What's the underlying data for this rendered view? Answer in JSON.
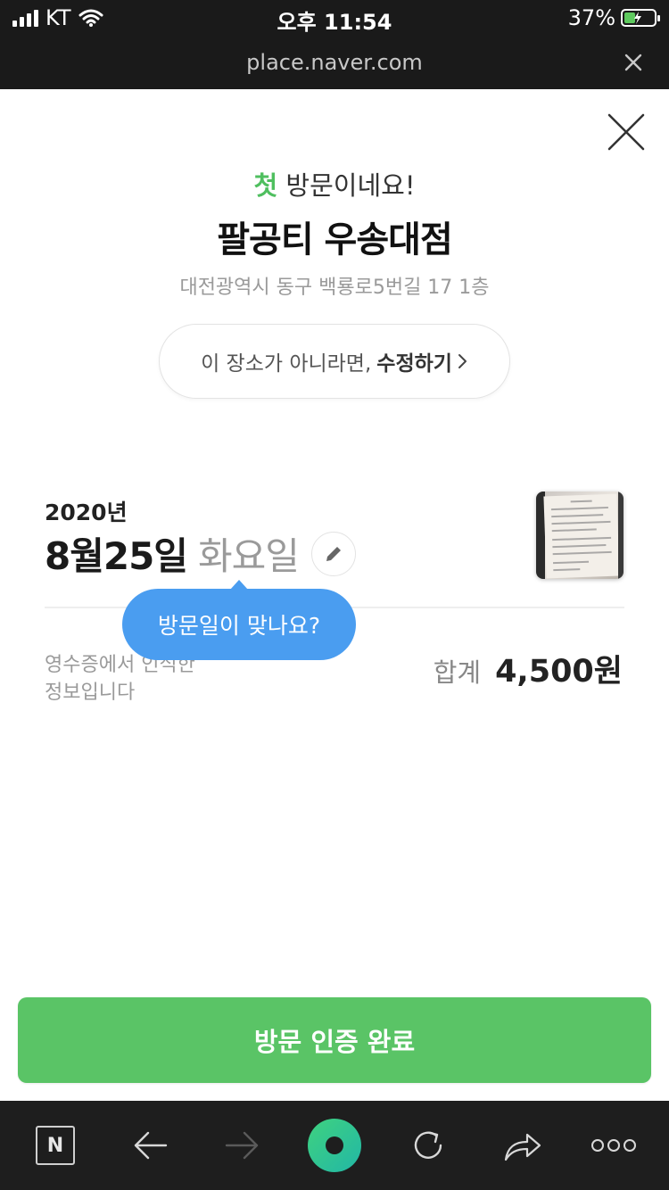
{
  "status_bar": {
    "carrier": "KT",
    "time": "오후 11:54",
    "battery": "37%",
    "battery_level": 0.37
  },
  "browser": {
    "url": "place.naver.com"
  },
  "visit": {
    "first_accent": "첫",
    "first_rest": " 방문이네요!",
    "place_name": "팔공티 우송대점",
    "address": "대전광역시 동구 백룡로5번길 17 1층",
    "edit_prompt": "이 장소가 아니라면,",
    "edit_link": "수정하기",
    "year": "2020년",
    "date": "8월25일",
    "weekday": "화요일",
    "tooltip": "방문일이 맞나요?",
    "ocr_note_line1": "영수증에서 인식한",
    "ocr_note_line2": "정보입니다",
    "total_label": "합계",
    "total_value": "4,500원",
    "confirm_button": "방문 인증 완료"
  },
  "colors": {
    "accent_green": "#5ac466",
    "tooltip_blue": "#4a9df0"
  },
  "icons": [
    "wifi-icon",
    "battery-icon",
    "close-icon",
    "chevron-right-icon",
    "pencil-icon",
    "naver-n-icon",
    "back-arrow-icon",
    "forward-arrow-icon",
    "home-icon",
    "reload-icon",
    "share-icon",
    "more-icon"
  ]
}
